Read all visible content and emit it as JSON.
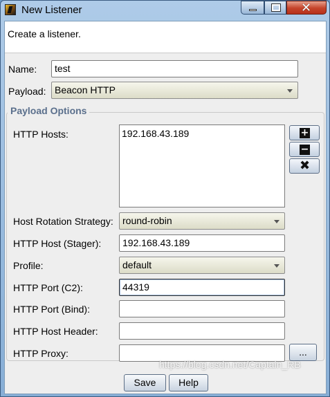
{
  "window": {
    "title": "New Listener",
    "controls": {
      "minimize_icon": "minimize-icon",
      "maximize_icon": "maximize-icon",
      "close_icon": "close-icon"
    }
  },
  "banner": {
    "text": "Create a listener."
  },
  "form": {
    "name": {
      "label": "Name:",
      "value": "test"
    },
    "payload": {
      "label": "Payload:",
      "value": "Beacon HTTP"
    }
  },
  "payload_options": {
    "title": "Payload Options",
    "http_hosts": {
      "label": "HTTP Hosts:",
      "values": [
        "192.168.43.189"
      ]
    },
    "host_buttons": {
      "add_icon": "plus-icon",
      "remove_icon": "minus-icon",
      "clear_icon": "x-icon"
    },
    "host_rotation": {
      "label": "Host Rotation Strategy:",
      "value": "round-robin"
    },
    "http_host_stager": {
      "label": "HTTP Host (Stager):",
      "value": "192.168.43.189"
    },
    "profile": {
      "label": "Profile:",
      "value": "default"
    },
    "http_port_c2": {
      "label": "HTTP Port (C2):",
      "value": "44319"
    },
    "http_port_bind": {
      "label": "HTTP Port (Bind):",
      "value": ""
    },
    "http_host_header": {
      "label": "HTTP Host Header:",
      "value": ""
    },
    "http_proxy": {
      "label": "HTTP Proxy:",
      "value": "",
      "browse_label": "..."
    }
  },
  "buttons": {
    "save": "Save",
    "help": "Help"
  },
  "watermark": "https://blog.csdn.net/Captain_RB",
  "colors": {
    "title_bar": "#aecbe8",
    "close_button": "#c4432a",
    "group_title": "#5a6f8c",
    "panel": "#eeeeee"
  }
}
